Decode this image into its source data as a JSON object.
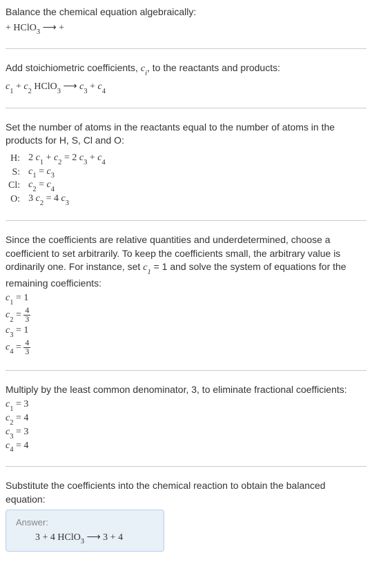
{
  "step1": {
    "text": "Balance the chemical equation algebraically:",
    "reaction_left": " + HClO",
    "reaction_sub": "3",
    "reaction_arrow": " ⟶ ",
    "reaction_right": " + "
  },
  "step2": {
    "text_a": "Add stoichiometric coefficients, ",
    "ci": "c",
    "ci_sub": "i",
    "text_b": ", to the reactants and products:",
    "eq_c1": "c",
    "eq_c1_sub": "1",
    "eq_plus1": "  + ",
    "eq_c2": "c",
    "eq_c2_sub": "2",
    "eq_hclo": " HClO",
    "eq_hclo_sub": "3",
    "eq_arrow": " ⟶ ",
    "eq_c3": "c",
    "eq_c3_sub": "3",
    "eq_plus2": "  + ",
    "eq_c4": "c",
    "eq_c4_sub": "4"
  },
  "step3": {
    "text": "Set the number of atoms in the reactants equal to the number of atoms in the products for H, S, Cl and O:",
    "rows": [
      {
        "label": "H:",
        "eq_pre": "2 ",
        "c1": "c",
        "c1s": "1",
        "mid1": " + ",
        "c2": "c",
        "c2s": "2",
        "eq": " = 2 ",
        "c3": "c",
        "c3s": "3",
        "mid2": " + ",
        "c4": "c",
        "c4s": "4"
      },
      {
        "label": "S:",
        "c1": "c",
        "c1s": "1",
        "eq": " = ",
        "c3": "c",
        "c3s": "3"
      },
      {
        "label": "Cl:",
        "c1": "c",
        "c1s": "2",
        "eq": " = ",
        "c3": "c",
        "c3s": "4"
      },
      {
        "label": "O:",
        "eq_pre": "3 ",
        "c1": "c",
        "c1s": "2",
        "eq": " = 4 ",
        "c3": "c",
        "c3s": "3"
      }
    ]
  },
  "step4": {
    "text_a": "Since the coefficients are relative quantities and underdetermined, choose a coefficient to set arbitrarily. To keep the coefficients small, the arbitrary value is ordinarily one. For instance, set ",
    "c1": "c",
    "c1_sub": "1",
    "text_b": " = 1 and solve the system of equations for the remaining coefficients:",
    "coefs": {
      "c1_label": "c",
      "c1_sub": "1",
      "c1_val": " = 1",
      "c2_label": "c",
      "c2_sub": "2",
      "c2_eq": " = ",
      "c2_num": "4",
      "c2_den": "3",
      "c3_label": "c",
      "c3_sub": "3",
      "c3_val": " = 1",
      "c4_label": "c",
      "c4_sub": "4",
      "c4_eq": " = ",
      "c4_num": "4",
      "c4_den": "3"
    }
  },
  "step5": {
    "text": "Multiply by the least common denominator, 3, to eliminate fractional coefficients:",
    "coefs": [
      {
        "c": "c",
        "sub": "1",
        "val": " = 3"
      },
      {
        "c": "c",
        "sub": "2",
        "val": " = 4"
      },
      {
        "c": "c",
        "sub": "3",
        "val": " = 3"
      },
      {
        "c": "c",
        "sub": "4",
        "val": " = 4"
      }
    ]
  },
  "step6": {
    "text": "Substitute the coefficients into the chemical reaction to obtain the balanced equation:"
  },
  "answer": {
    "label": "Answer:",
    "left": "3  + 4 HClO",
    "sub": "3",
    "arrow": " ⟶ ",
    "right": "3  + 4 "
  }
}
